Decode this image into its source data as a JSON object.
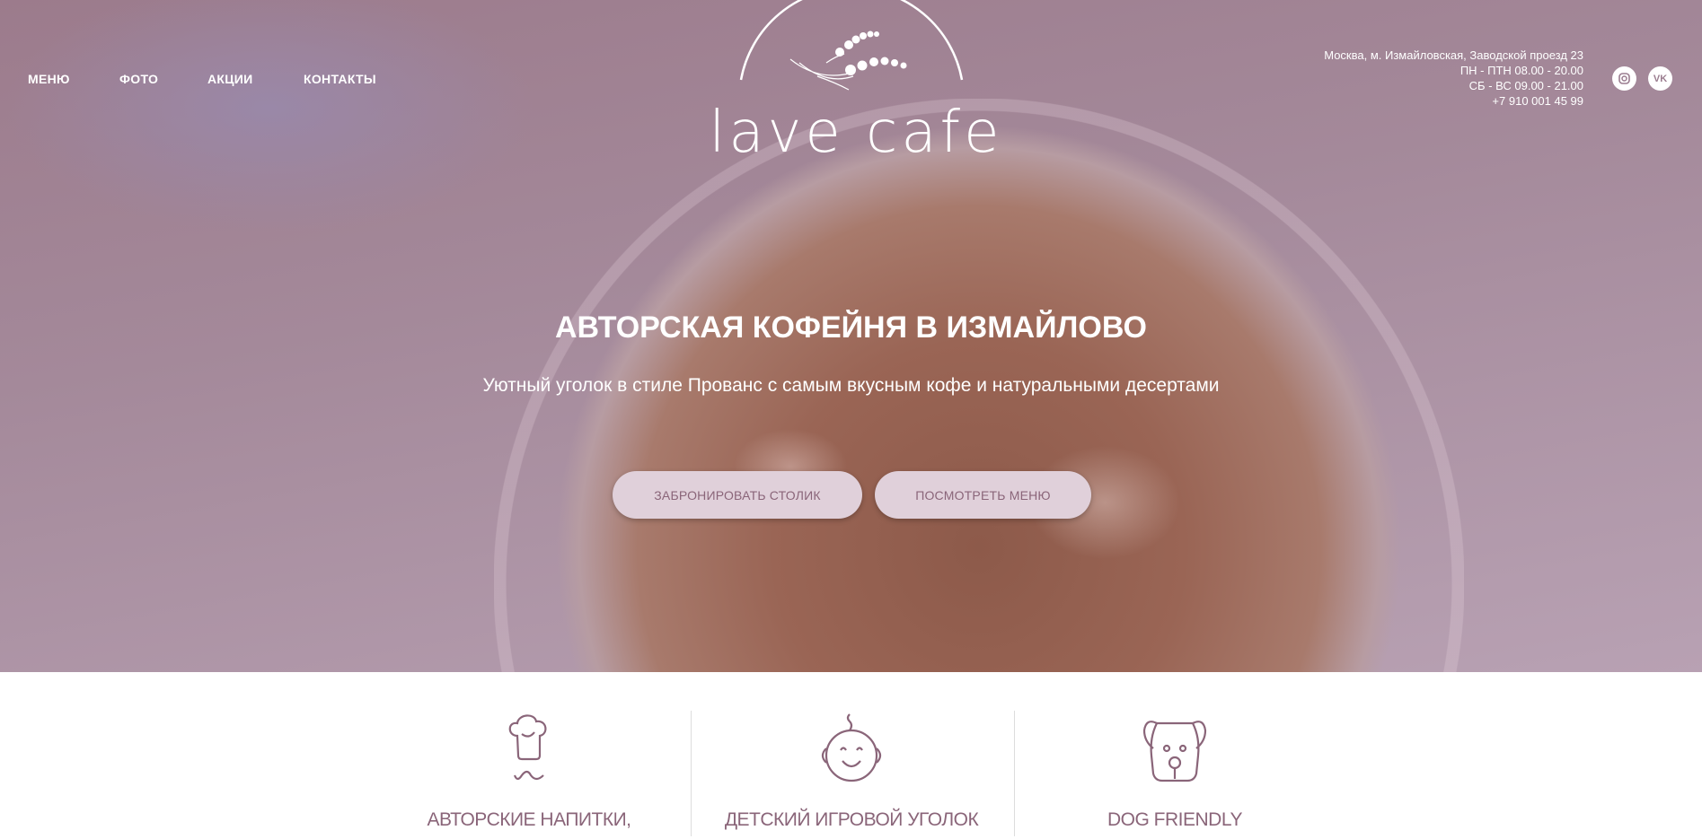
{
  "nav": {
    "items": [
      "МЕНЮ",
      "ФОТО",
      "АКЦИИ",
      "КОНТАКТЫ"
    ]
  },
  "logo": {
    "text": "lave cafe"
  },
  "contacts": {
    "address": "Москва, м. Измайловская, Заводской проезд 23",
    "weekdays": "ПН - ПТН 08.00 - 20.00",
    "weekend": "СБ - ВС 09.00 - 21.00",
    "phone": "+7 910 001 45 99"
  },
  "social": {
    "instagram": "instagram-icon",
    "vk": "VK"
  },
  "hero": {
    "title": "АВТОРСКАЯ КОФЕЙНЯ В ИЗМАЙЛОВО",
    "subtitle": "Уютный уголок в стиле Прованс с самым вкусным кофе и натуральными десертами",
    "book_label": "ЗАБРОНИРОВАТЬ СТОЛИК",
    "menu_label": "ПОСМОТРЕТЬ МЕНЮ"
  },
  "features": [
    {
      "title": "АВТОРСКИЕ НАПИТКИ,",
      "icon": "chef-icon"
    },
    {
      "title": "ДЕТСКИЙ ИГРОВОЙ УГОЛОК",
      "icon": "baby-icon"
    },
    {
      "title": "DOG FRIENDLY",
      "icon": "dog-icon"
    }
  ],
  "colors": {
    "accent": "#8a6579",
    "button_bg": "#e0d0da"
  }
}
